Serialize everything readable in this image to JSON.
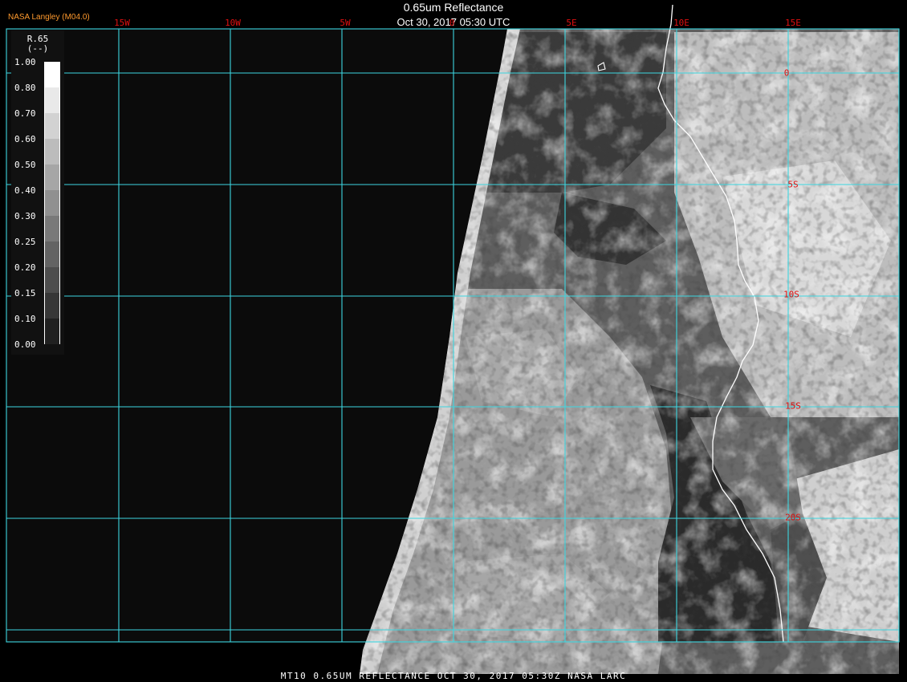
{
  "header": {
    "title": "0.65um Reflectance",
    "subtitle": "Oct 30, 2017 05:30 UTC",
    "organization": "NASA Langley (M04.0)"
  },
  "footer": {
    "text": "MT10  0.65UM REFLECTANCE   OCT 30, 2017 05:30Z   NASA LARC"
  },
  "map": {
    "longitude_labels": [
      "15W",
      "10W",
      "5W",
      "0",
      "5E",
      "10E",
      "15E"
    ],
    "latitude_labels": [
      "0",
      "5S",
      "10S",
      "15S",
      "20S"
    ],
    "colors": {
      "grid": "#3cd6e0",
      "labels": "#e01010",
      "coastline": "#ffffff",
      "space": "#000000"
    }
  },
  "legend": {
    "variable": "R.65",
    "units": "(--)",
    "ticks": [
      "1.00",
      "0.80",
      "0.70",
      "0.60",
      "0.50",
      "0.40",
      "0.30",
      "0.25",
      "0.20",
      "0.15",
      "0.10",
      "0.00"
    ]
  }
}
